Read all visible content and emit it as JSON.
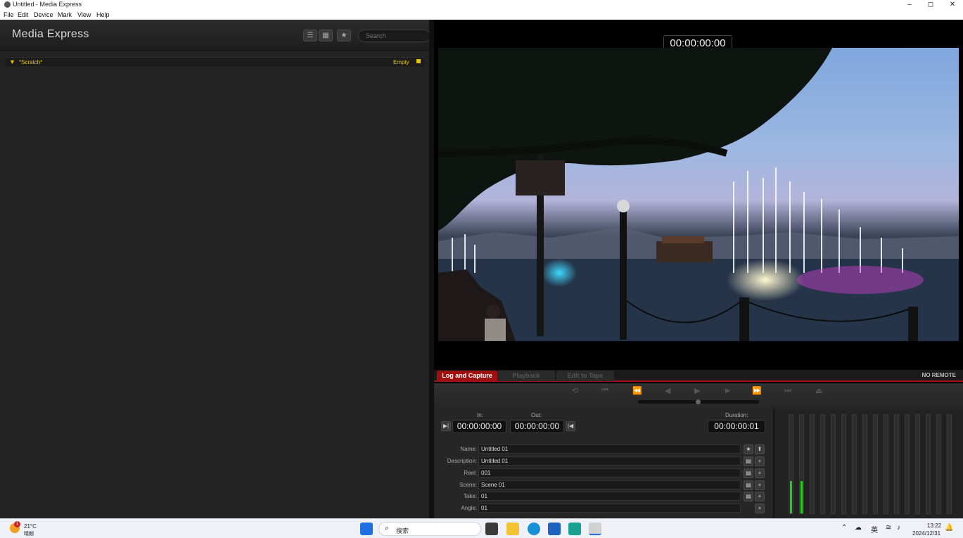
{
  "window": {
    "title": "Untitled - Media Express",
    "minimize": "–",
    "maximize": "◻",
    "close": "✕"
  },
  "menu": [
    "File",
    "Edit",
    "Device",
    "Mark",
    "View",
    "Help"
  ],
  "header": {
    "app_name": "Media Express",
    "search_placeholder": "Search",
    "list_view_icon": "☰",
    "grid_view_icon": "▦",
    "favorite_icon": "★"
  },
  "bin": {
    "name": "*Scratch*",
    "status": "Empty"
  },
  "viewer": {
    "timecode": "00:00:00:00"
  },
  "tabs": {
    "log_capture": "Log and Capture",
    "playback": "Playback",
    "edit_to_tape": "Edit to Tape",
    "remote_status": "NO REMOTE"
  },
  "transport": {
    "loop": "⟲",
    "to_start": "⏮",
    "rewind": "⏪",
    "step_back": "◀",
    "play": "▶",
    "step_forward": "▶",
    "fast_forward": "⏩",
    "to_end": "⏭",
    "eject": "⏏"
  },
  "log": {
    "in_label": "In:",
    "out_label": "Out:",
    "duration_label": "Duration:",
    "in_tc": "00:00:00:00",
    "out_tc": "00:00:00:00",
    "duration_tc": "00:00:00:01",
    "fields": [
      {
        "label": "Name:",
        "value": "Untitled 01"
      },
      {
        "label": "Description:",
        "value": "Untitled 01"
      },
      {
        "label": "Reel:",
        "value": "001"
      },
      {
        "label": "Scene:",
        "value": "Scene 01"
      },
      {
        "label": "Take:",
        "value": "01"
      },
      {
        "label": "Angle:",
        "value": "01"
      }
    ]
  },
  "meters": {
    "channel_count": 16,
    "active_levels": [
      0.33,
      0.33
    ]
  },
  "taskbar": {
    "weather_temp": "21°C",
    "weather_desc": "晴朗",
    "search_label": "搜索",
    "ime": "英",
    "time": "13:22",
    "date": "2024/12/31",
    "weather_badge": "1"
  },
  "colors": {
    "accent_red": "#a01010",
    "bin_yellow": "#e7c300",
    "meter_green": "#1cd01c"
  }
}
